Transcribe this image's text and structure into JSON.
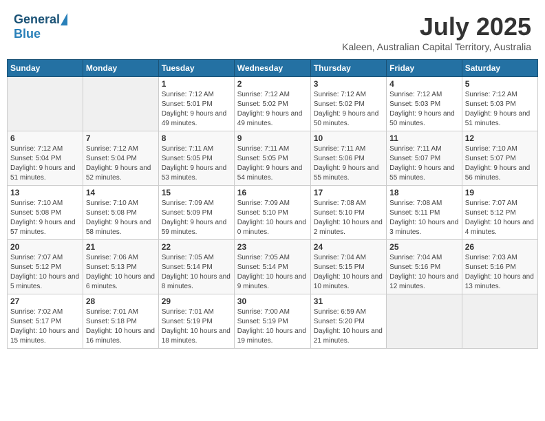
{
  "header": {
    "logo_general": "General",
    "logo_blue": "Blue",
    "title": "July 2025",
    "subtitle": "Kaleen, Australian Capital Territory, Australia"
  },
  "days_of_week": [
    "Sunday",
    "Monday",
    "Tuesday",
    "Wednesday",
    "Thursday",
    "Friday",
    "Saturday"
  ],
  "weeks": [
    [
      {
        "day": "",
        "info": ""
      },
      {
        "day": "",
        "info": ""
      },
      {
        "day": "1",
        "info": "Sunrise: 7:12 AM\nSunset: 5:01 PM\nDaylight: 9 hours and 49 minutes."
      },
      {
        "day": "2",
        "info": "Sunrise: 7:12 AM\nSunset: 5:02 PM\nDaylight: 9 hours and 49 minutes."
      },
      {
        "day": "3",
        "info": "Sunrise: 7:12 AM\nSunset: 5:02 PM\nDaylight: 9 hours and 50 minutes."
      },
      {
        "day": "4",
        "info": "Sunrise: 7:12 AM\nSunset: 5:03 PM\nDaylight: 9 hours and 50 minutes."
      },
      {
        "day": "5",
        "info": "Sunrise: 7:12 AM\nSunset: 5:03 PM\nDaylight: 9 hours and 51 minutes."
      }
    ],
    [
      {
        "day": "6",
        "info": "Sunrise: 7:12 AM\nSunset: 5:04 PM\nDaylight: 9 hours and 51 minutes."
      },
      {
        "day": "7",
        "info": "Sunrise: 7:12 AM\nSunset: 5:04 PM\nDaylight: 9 hours and 52 minutes."
      },
      {
        "day": "8",
        "info": "Sunrise: 7:11 AM\nSunset: 5:05 PM\nDaylight: 9 hours and 53 minutes."
      },
      {
        "day": "9",
        "info": "Sunrise: 7:11 AM\nSunset: 5:05 PM\nDaylight: 9 hours and 54 minutes."
      },
      {
        "day": "10",
        "info": "Sunrise: 7:11 AM\nSunset: 5:06 PM\nDaylight: 9 hours and 55 minutes."
      },
      {
        "day": "11",
        "info": "Sunrise: 7:11 AM\nSunset: 5:07 PM\nDaylight: 9 hours and 55 minutes."
      },
      {
        "day": "12",
        "info": "Sunrise: 7:10 AM\nSunset: 5:07 PM\nDaylight: 9 hours and 56 minutes."
      }
    ],
    [
      {
        "day": "13",
        "info": "Sunrise: 7:10 AM\nSunset: 5:08 PM\nDaylight: 9 hours and 57 minutes."
      },
      {
        "day": "14",
        "info": "Sunrise: 7:10 AM\nSunset: 5:08 PM\nDaylight: 9 hours and 58 minutes."
      },
      {
        "day": "15",
        "info": "Sunrise: 7:09 AM\nSunset: 5:09 PM\nDaylight: 9 hours and 59 minutes."
      },
      {
        "day": "16",
        "info": "Sunrise: 7:09 AM\nSunset: 5:10 PM\nDaylight: 10 hours and 0 minutes."
      },
      {
        "day": "17",
        "info": "Sunrise: 7:08 AM\nSunset: 5:10 PM\nDaylight: 10 hours and 2 minutes."
      },
      {
        "day": "18",
        "info": "Sunrise: 7:08 AM\nSunset: 5:11 PM\nDaylight: 10 hours and 3 minutes."
      },
      {
        "day": "19",
        "info": "Sunrise: 7:07 AM\nSunset: 5:12 PM\nDaylight: 10 hours and 4 minutes."
      }
    ],
    [
      {
        "day": "20",
        "info": "Sunrise: 7:07 AM\nSunset: 5:12 PM\nDaylight: 10 hours and 5 minutes."
      },
      {
        "day": "21",
        "info": "Sunrise: 7:06 AM\nSunset: 5:13 PM\nDaylight: 10 hours and 6 minutes."
      },
      {
        "day": "22",
        "info": "Sunrise: 7:05 AM\nSunset: 5:14 PM\nDaylight: 10 hours and 8 minutes."
      },
      {
        "day": "23",
        "info": "Sunrise: 7:05 AM\nSunset: 5:14 PM\nDaylight: 10 hours and 9 minutes."
      },
      {
        "day": "24",
        "info": "Sunrise: 7:04 AM\nSunset: 5:15 PM\nDaylight: 10 hours and 10 minutes."
      },
      {
        "day": "25",
        "info": "Sunrise: 7:04 AM\nSunset: 5:16 PM\nDaylight: 10 hours and 12 minutes."
      },
      {
        "day": "26",
        "info": "Sunrise: 7:03 AM\nSunset: 5:16 PM\nDaylight: 10 hours and 13 minutes."
      }
    ],
    [
      {
        "day": "27",
        "info": "Sunrise: 7:02 AM\nSunset: 5:17 PM\nDaylight: 10 hours and 15 minutes."
      },
      {
        "day": "28",
        "info": "Sunrise: 7:01 AM\nSunset: 5:18 PM\nDaylight: 10 hours and 16 minutes."
      },
      {
        "day": "29",
        "info": "Sunrise: 7:01 AM\nSunset: 5:19 PM\nDaylight: 10 hours and 18 minutes."
      },
      {
        "day": "30",
        "info": "Sunrise: 7:00 AM\nSunset: 5:19 PM\nDaylight: 10 hours and 19 minutes."
      },
      {
        "day": "31",
        "info": "Sunrise: 6:59 AM\nSunset: 5:20 PM\nDaylight: 10 hours and 21 minutes."
      },
      {
        "day": "",
        "info": ""
      },
      {
        "day": "",
        "info": ""
      }
    ]
  ]
}
